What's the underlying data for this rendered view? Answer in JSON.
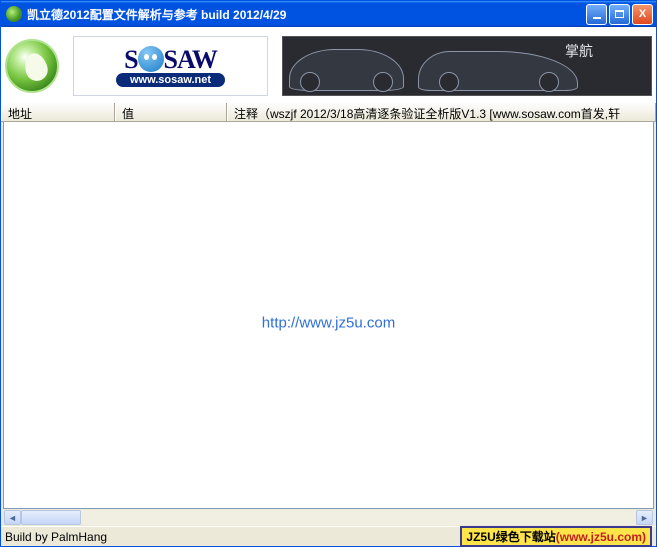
{
  "window": {
    "title": "凯立德2012配置文件解析与参考 build 2012/4/29"
  },
  "banner": {
    "sosaw_text_left": "S",
    "sosaw_text_right": "SAW",
    "sosaw_url": "www.sosaw.net",
    "car_label": "掌航"
  },
  "headers": {
    "address": "地址",
    "value": "值",
    "note": "注释（wszjf 2012/3/18高清逐条验证全析版V1.3 [www.sosaw.com首发,轩"
  },
  "watermark": "http://www.jz5u.com",
  "status": {
    "left": "Build by PalmHang",
    "badge_label": "JZ5U绿色下载站",
    "badge_url": "(www.jz5u.com)"
  }
}
